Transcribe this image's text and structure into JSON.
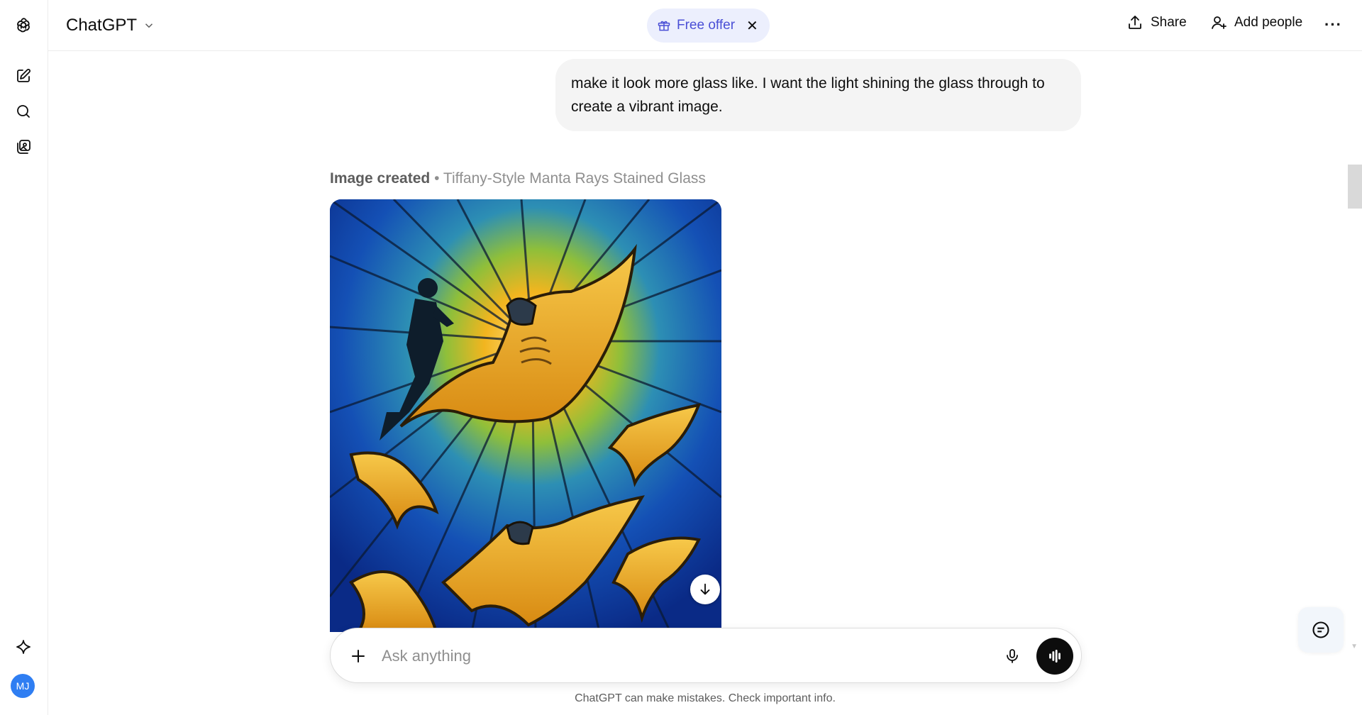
{
  "app": {
    "name": "ChatGPT"
  },
  "sidebar": {
    "items": [
      {
        "icon": "new-chat-icon"
      },
      {
        "icon": "search-icon"
      },
      {
        "icon": "library-icon"
      }
    ],
    "bottom_icon": "sparkle-icon",
    "avatar_initials": "MJ"
  },
  "header": {
    "model_label": "ChatGPT",
    "offer_label": "Free offer",
    "share_label": "Share",
    "add_people_label": "Add people"
  },
  "conversation": {
    "user_message": "make it look more glass like. I want the light shining the glass through to create a vibrant image.",
    "image_status": "Image created",
    "image_title": "• Tiffany-Style Manta Rays Stained Glass"
  },
  "composer": {
    "placeholder": "Ask anything"
  },
  "disclaimer": "ChatGPT can make mistakes. Check important info.",
  "colors": {
    "accent_offer_bg": "#eceffd",
    "accent_offer_text": "#4a4fd6",
    "avatar_bg": "#2f7ef2",
    "bubble_bg": "#f4f4f4",
    "glass_blue": "#0a3aa8",
    "glass_gold": "#e8a41a"
  }
}
